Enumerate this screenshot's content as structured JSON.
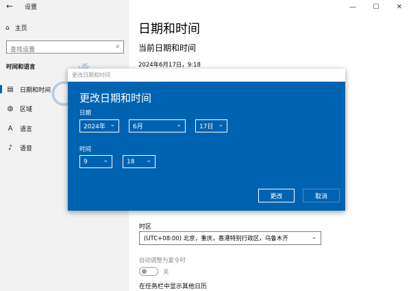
{
  "window": {
    "title": "设置",
    "controls": [
      "—",
      "☐",
      "✕"
    ]
  },
  "nav": {
    "home": "主页",
    "search_placeholder": "查找设置",
    "section": "时间和语言",
    "items": [
      {
        "label": "日期和时间",
        "icon": "calendar-icon",
        "selected": true
      },
      {
        "label": "区域",
        "icon": "globe-icon",
        "selected": false
      },
      {
        "label": "语言",
        "icon": "language-icon",
        "selected": false
      },
      {
        "label": "语音",
        "icon": "microphone-icon",
        "selected": false
      }
    ]
  },
  "main": {
    "title": "日期和时间",
    "subtitle": "当前日期和时间",
    "current_datetime": "2024年6月17日，9:18",
    "timezone_label": "时区",
    "timezone_value": "(UTC+08:00) 北京，重庆，香港特别行政区，乌鲁木齐",
    "dst_label": "自动调整为夏令时",
    "dst_state": "关",
    "extra_calendars": "在任务栏中显示其他日历"
  },
  "dialog": {
    "titlebar": "更改日期和时间",
    "heading": "更改日期和时间",
    "date_label": "日期",
    "year": "2024年",
    "month": "6月",
    "day": "17日",
    "time_label": "时间",
    "hour": "9",
    "minute": "18",
    "change_button": "更改",
    "cancel_button": "取消"
  },
  "colors": {
    "accent": "#0063b1",
    "nav_background": "#f2f2f2"
  }
}
